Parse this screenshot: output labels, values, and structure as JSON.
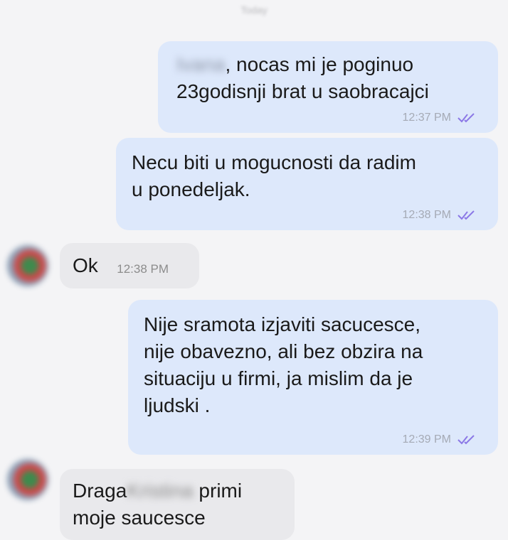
{
  "chat": {
    "date_header": "Today",
    "messages": [
      {
        "sender_name": "Ivana",
        "text_after_name": ", nocas mi je poginuo",
        "text_line2": "23godisnji brat u saobracajci",
        "time": "12:37 PM"
      },
      {
        "text_line1": "Necu biti u mogucnosti da radim",
        "text_line2": "u ponedeljak.",
        "time": "12:38 PM"
      },
      {
        "text": "Ok",
        "time": "12:38 PM"
      },
      {
        "lines": [
          "Nije sramota izjaviti sacucesce,",
          "nije obavezno, ali bez obzira na",
          "situaciju u firmi, ja mislim da je",
          "ljudski ."
        ],
        "time": "12:39 PM"
      },
      {
        "text_before_name": "Draga",
        "name": "Kristina",
        "text_after_name": " primi",
        "text_line2": "moje saucesce"
      }
    ]
  },
  "colors": {
    "outgoing_bubble": "#dde8fb",
    "incoming_bubble": "#e9e9ec",
    "read_ticks": "#8b78e6",
    "background": "#f4f4f6"
  },
  "icons": {
    "read_receipt": "double-check-icon",
    "avatar": "contact-avatar"
  }
}
